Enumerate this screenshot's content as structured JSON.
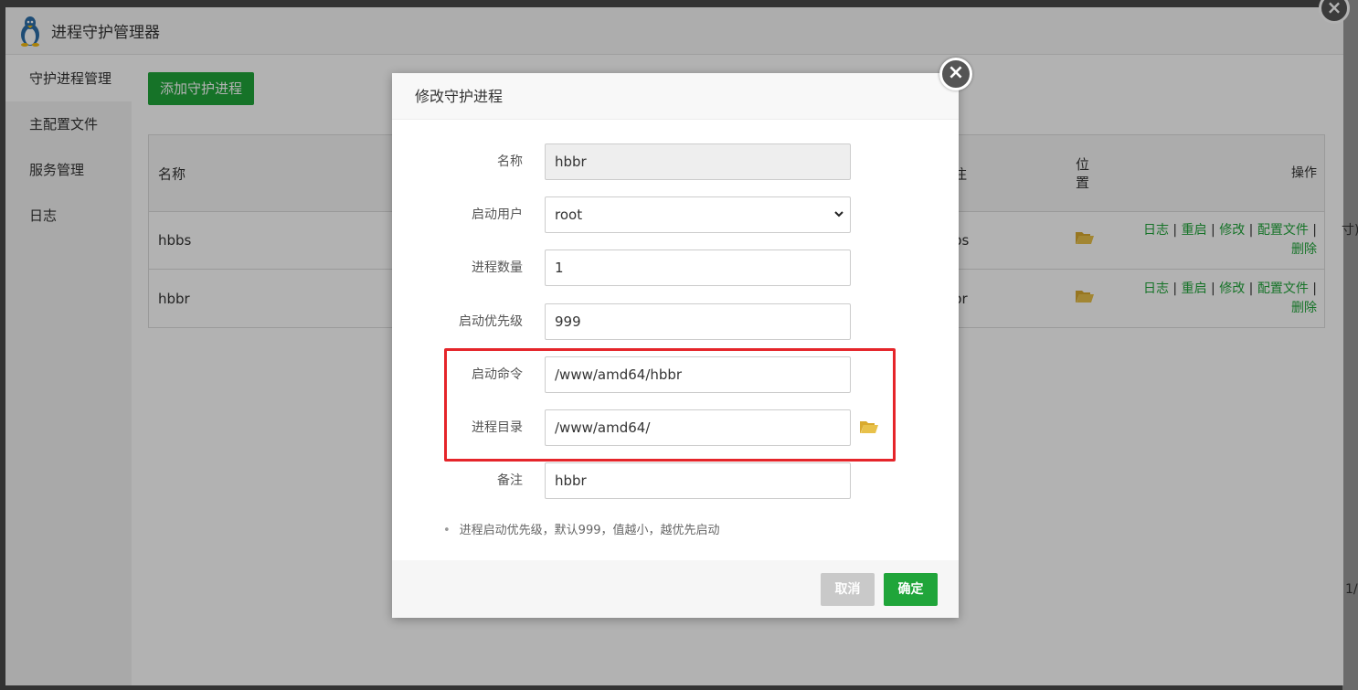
{
  "window": {
    "title": "进程守护管理器",
    "close_glyph": "×"
  },
  "sidebar": {
    "items": [
      {
        "label": "守护进程管理"
      },
      {
        "label": "主配置文件"
      },
      {
        "label": "服务管理"
      },
      {
        "label": "日志"
      }
    ]
  },
  "toolbar": {
    "add_label": "添加守护进程"
  },
  "table": {
    "headers": {
      "name": "名称",
      "note": "注",
      "pos_line1": "位",
      "pos_line2": "置",
      "op": "操作"
    },
    "rows": [
      {
        "name": "hbbs",
        "note": "bs"
      },
      {
        "name": "hbbr",
        "note": "br"
      }
    ],
    "actions": {
      "log": "日志",
      "restart": "重启",
      "edit": "修改",
      "config": "配置文件",
      "delete": "删除",
      "sep": "|"
    }
  },
  "right_edge": {
    "text1": "寸)",
    "text2": "1/"
  },
  "modal": {
    "title": "修改守护进程",
    "close_glyph": "×",
    "fields": {
      "name": {
        "label": "名称",
        "value": "hbbr"
      },
      "user": {
        "label": "启动用户",
        "value": "root"
      },
      "count": {
        "label": "进程数量",
        "value": "1"
      },
      "priority": {
        "label": "启动优先级",
        "value": "999"
      },
      "command": {
        "label": "启动命令",
        "value": "/www/amd64/hbbr"
      },
      "dir": {
        "label": "进程目录",
        "value": "/www/amd64/"
      },
      "note": {
        "label": "备注",
        "value": "hbbr"
      }
    },
    "tip": "进程启动优先级，默认999，值越小，越优先启动",
    "cancel_label": "取消",
    "ok_label": "确定"
  },
  "colors": {
    "accent": "#20a53a",
    "highlight": "#e5252a",
    "folder": "#e8c14a"
  }
}
